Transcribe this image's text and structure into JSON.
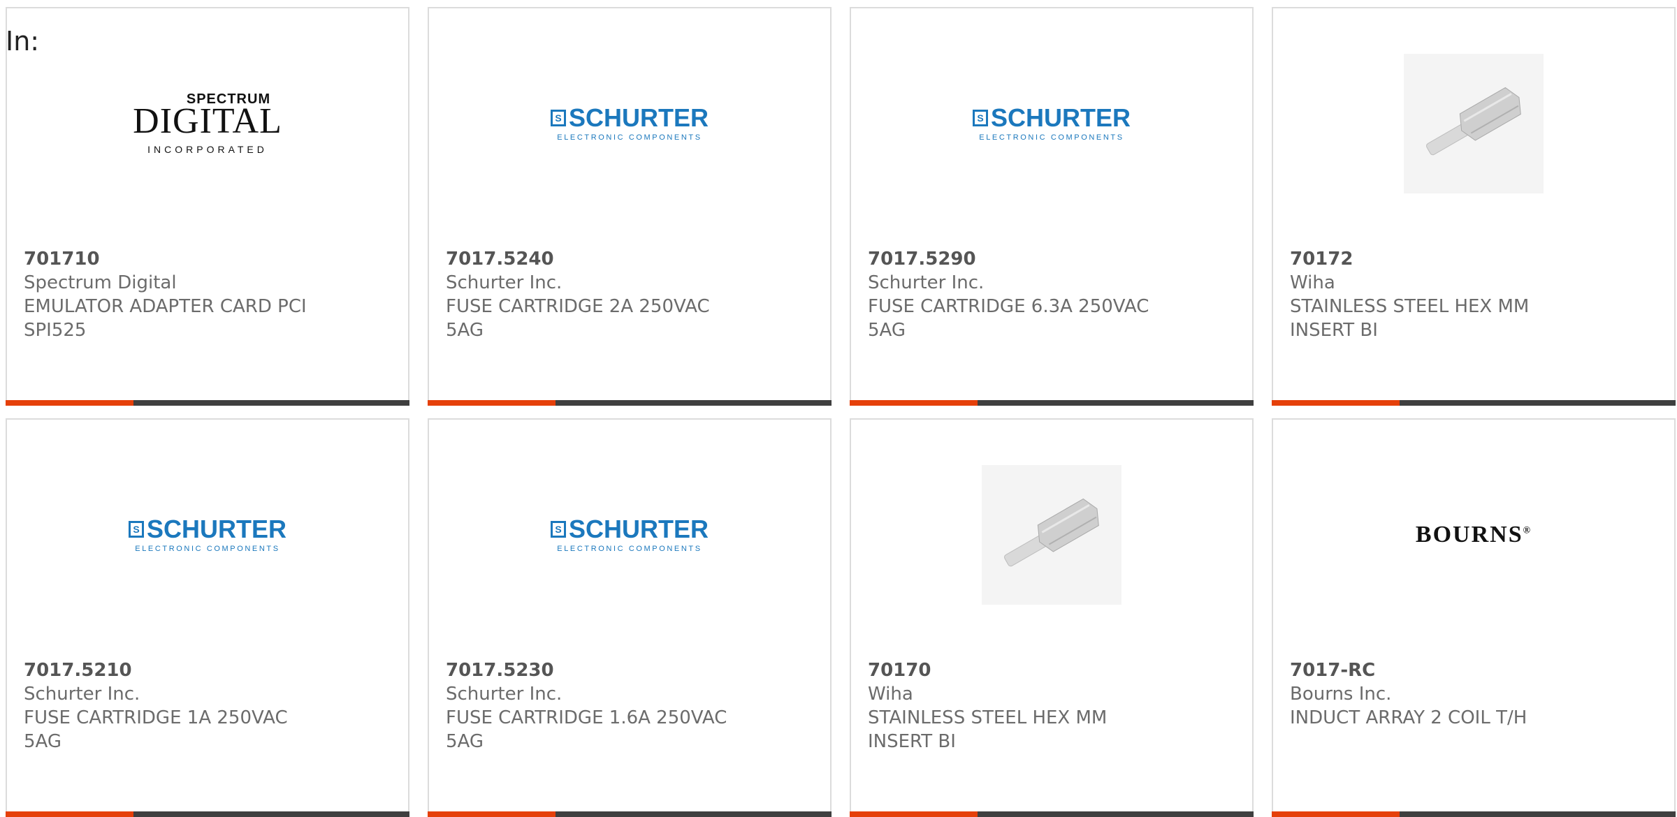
{
  "header": {
    "label": "In:"
  },
  "products": [
    {
      "part_number": "701710",
      "manufacturer": "Spectrum Digital",
      "description_line1": "EMULATOR ADAPTER CARD PCI",
      "description_line2": "SPI525",
      "logo": {
        "kind": "spectrum",
        "top": "SPECTRUM",
        "main": "DIGITAL",
        "sub": "INCORPORATED"
      }
    },
    {
      "part_number": "7017.5240",
      "manufacturer": "Schurter Inc.",
      "description_line1": "FUSE CARTRIDGE 2A 250VAC",
      "description_line2": "5AG",
      "logo": {
        "kind": "schurter",
        "main": "SCHURTER",
        "sub": "ELECTRONIC COMPONENTS"
      }
    },
    {
      "part_number": "7017.5290",
      "manufacturer": "Schurter Inc.",
      "description_line1": "FUSE CARTRIDGE 6.3A 250VAC",
      "description_line2": "5AG",
      "logo": {
        "kind": "schurter",
        "main": "SCHURTER",
        "sub": "ELECTRONIC COMPONENTS"
      }
    },
    {
      "part_number": "70172",
      "manufacturer": "Wiha",
      "description_line1": "STAINLESS STEEL HEX MM",
      "description_line2": "INSERT BI",
      "logo": {
        "kind": "bit-photo"
      }
    },
    {
      "part_number": "7017.5210",
      "manufacturer": "Schurter Inc.",
      "description_line1": "FUSE CARTRIDGE 1A 250VAC",
      "description_line2": "5AG",
      "logo": {
        "kind": "schurter",
        "main": "SCHURTER",
        "sub": "ELECTRONIC COMPONENTS"
      }
    },
    {
      "part_number": "7017.5230",
      "manufacturer": "Schurter Inc.",
      "description_line1": "FUSE CARTRIDGE 1.6A 250VAC",
      "description_line2": "5AG",
      "logo": {
        "kind": "schurter",
        "main": "SCHURTER",
        "sub": "ELECTRONIC COMPONENTS"
      }
    },
    {
      "part_number": "70170",
      "manufacturer": "Wiha",
      "description_line1": "STAINLESS STEEL HEX MM",
      "description_line2": "INSERT BI",
      "logo": {
        "kind": "bit-photo"
      }
    },
    {
      "part_number": "7017-RC",
      "manufacturer": "Bourns Inc.",
      "description_line1": "INDUCT ARRAY 2 COIL T/H",
      "description_line2": "",
      "logo": {
        "kind": "bourns",
        "main": "BOURNS",
        "mark": "®"
      }
    }
  ],
  "colors": {
    "accent": "#e5400a",
    "bar": "#3f3f3f",
    "schurter_blue": "#1b78bd",
    "text": "#6b6b6b"
  }
}
